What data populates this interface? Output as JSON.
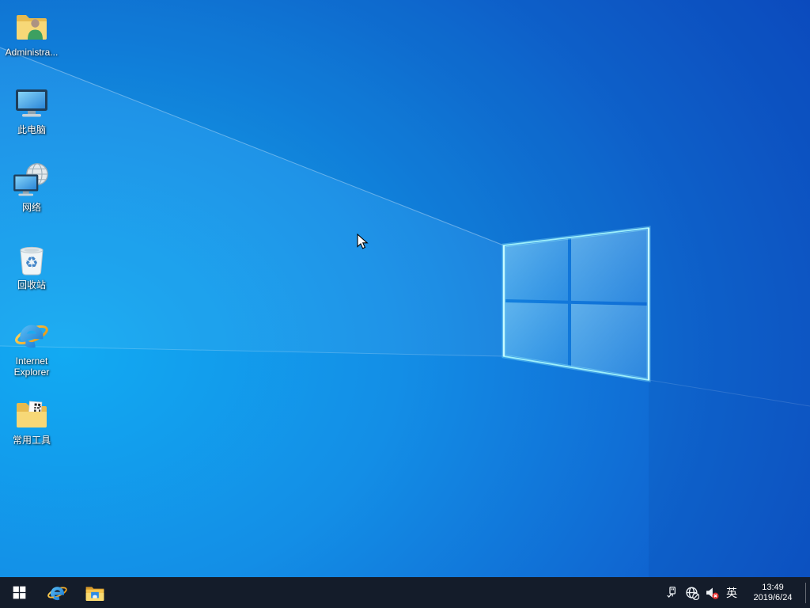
{
  "desktop": {
    "icons": [
      {
        "id": "administrator-folder",
        "label": "Administra..."
      },
      {
        "id": "this-pc",
        "label": "此电脑"
      },
      {
        "id": "network",
        "label": "网络"
      },
      {
        "id": "recycle-bin",
        "label": "回收站"
      },
      {
        "id": "internet-explorer",
        "label": "Internet Explorer"
      },
      {
        "id": "common-tools-folder",
        "label": "常用工具"
      }
    ]
  },
  "taskbar": {
    "apps": [
      {
        "id": "start-button"
      },
      {
        "id": "internet-explorer"
      },
      {
        "id": "file-explorer"
      }
    ],
    "tray": {
      "icons": [
        {
          "id": "usb-device"
        },
        {
          "id": "network-globe-offline"
        },
        {
          "id": "volume-muted"
        }
      ],
      "ime_indicator": "英",
      "clock": {
        "time": "13:49",
        "date": "2019/6/24"
      }
    }
  },
  "colors": {
    "taskbar_bg": "#141c2a",
    "wallpaper_deep_blue": "#0b47c0",
    "wallpaper_bright_cyan": "#12aaf2",
    "logo_edge_cyan": "#a9f2ff",
    "mute_badge_red": "#e33131",
    "folder_yellow": "#f7d877"
  }
}
